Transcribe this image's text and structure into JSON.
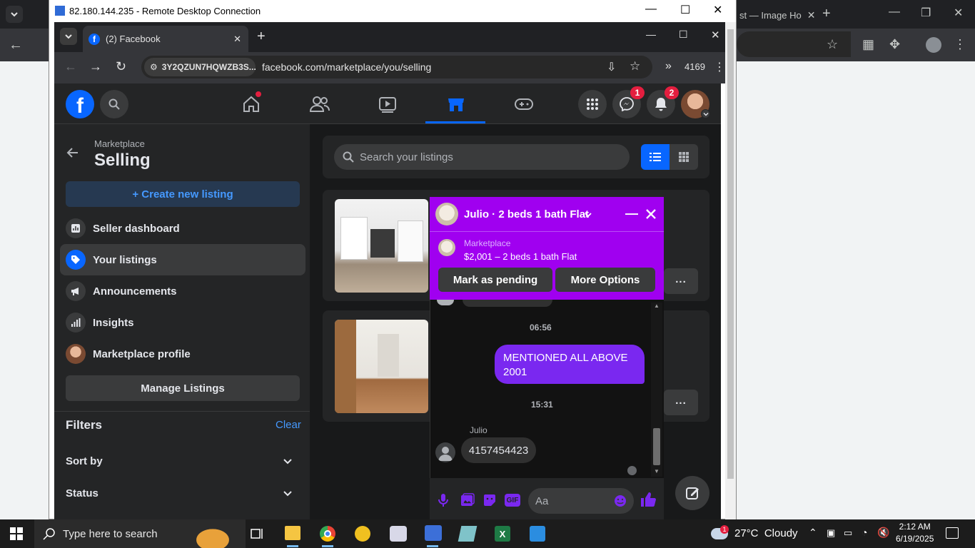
{
  "host": {
    "tab_partial": "st — Image Ho"
  },
  "rdp": {
    "title": "82.180.144.235 - Remote Desktop Connection"
  },
  "browser": {
    "tab_title": "(2) Facebook",
    "site_badge": "3Y2QZUN7HQWZB3S...",
    "url": "facebook.com/marketplace/you/selling",
    "ext_count": "4169"
  },
  "fb": {
    "messenger_badge": "1",
    "notif_badge": "2",
    "sidebar": {
      "breadcrumb": "Marketplace",
      "title": "Selling",
      "create_label": "+ Create new listing",
      "items": [
        {
          "label": "Seller dashboard",
          "icon": "dashboard-icon"
        },
        {
          "label": "Your listings",
          "icon": "tag-icon"
        },
        {
          "label": "Announcements",
          "icon": "megaphone-icon"
        },
        {
          "label": "Insights",
          "icon": "insights-icon"
        },
        {
          "label": "Marketplace profile",
          "icon": "avatar"
        }
      ],
      "manage_label": "Manage Listings",
      "filters_label": "Filters",
      "clear_label": "Clear",
      "sort_label": "Sort by",
      "status_label": "Status"
    },
    "search_placeholder": "Search your listings",
    "more_label": "..."
  },
  "chat": {
    "header_title": "Julio · 2 beds 1 bath Flat",
    "mp_label": "Marketplace",
    "mp_listing": "$2,001 – 2 beds 1 bath Flat",
    "pending_label": "Mark as pending",
    "options_label": "More Options",
    "time1": "06:56",
    "outgoing": "MENTIONED ALL ABOVE 2001",
    "time2": "15:31",
    "sender": "Julio",
    "incoming": "4157454423",
    "input_placeholder": "Aa",
    "gif_label": "GIF"
  },
  "taskbar": {
    "search_placeholder": "Type here to search",
    "weather": "27°C  Cloudy",
    "weather_badge": "1",
    "time": "2:12 AM",
    "date": "6/19/2025"
  },
  "colors": {
    "fb_blue": "#0866ff",
    "chat_purple": "#a000f0",
    "bubble_out": "#7a28f0",
    "badge_red": "#e41e3f"
  }
}
